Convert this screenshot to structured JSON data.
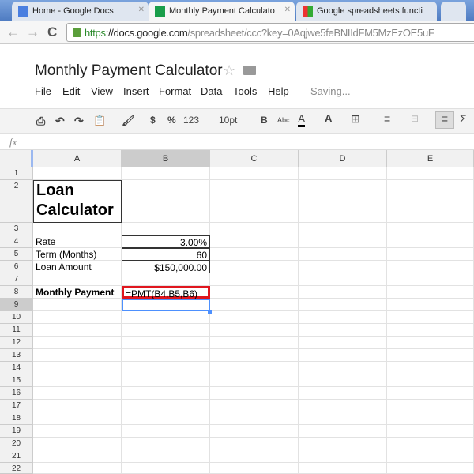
{
  "browser": {
    "tabs": [
      {
        "label": "Home - Google Docs",
        "active": false,
        "icon": "docs-icon"
      },
      {
        "label": "Monthly Payment Calculato",
        "active": true,
        "icon": "sheets-icon"
      },
      {
        "label": "Google spreadsheets functi",
        "active": false,
        "icon": "google-icon"
      }
    ],
    "url_scheme": "https",
    "url_host": "://docs.google.com",
    "url_path": "/spreadsheet/ccc?key=0Aqjwe5feBNIIdFM5MzEzOE5uF"
  },
  "doc": {
    "title": "Monthly Payment Calculator",
    "status": "Saving..."
  },
  "menu": [
    "File",
    "Edit",
    "View",
    "Insert",
    "Format",
    "Data",
    "Tools",
    "Help"
  ],
  "toolbar": {
    "currency": "$",
    "percent": "%",
    "number_format": "123",
    "font_size": "10pt",
    "bold": "B",
    "strike": "Abc",
    "text_color": "A",
    "fill": "A",
    "sum": "Σ"
  },
  "formula_bar": {
    "label": "fx",
    "value": ""
  },
  "columns": [
    "A",
    "B",
    "C",
    "D",
    "E"
  ],
  "selected_column": "B",
  "selected_row": 9,
  "rows": [
    1,
    2,
    3,
    4,
    5,
    6,
    7,
    8,
    9,
    10,
    11,
    12,
    13,
    14,
    15,
    16,
    17,
    18,
    19,
    20,
    21,
    22
  ],
  "cells": {
    "A2": "Loan Calculator",
    "A4": "Rate",
    "B4": "3.00%",
    "A5": "Term (Months)",
    "B5": "60",
    "A6": "Loan Amount",
    "B6": "$150,000.00",
    "A8": "Monthly Payment",
    "B8": "=PMT(B4,B5,B6)"
  },
  "colors": {
    "highlight": "#e0161e",
    "selection": "#4d90fe"
  }
}
